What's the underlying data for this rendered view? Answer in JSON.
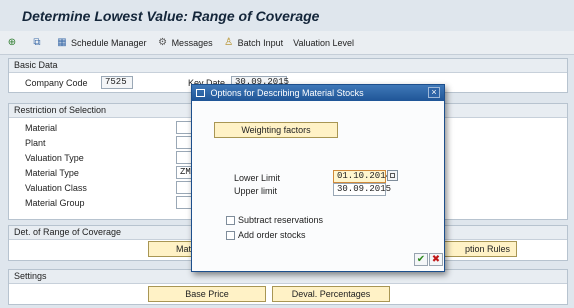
{
  "title": "Determine Lowest Value: Range of Coverage",
  "toolbar": {
    "schedule_manager": "Schedule Manager",
    "messages": "Messages",
    "batch_input": "Batch Input",
    "valuation_level": "Valuation Level"
  },
  "basic_data": {
    "header": "Basic Data",
    "company_code_label": "Company Code",
    "company_code_value": "7525",
    "key_date_label": "Key Date",
    "key_date_value": "30.09.2015"
  },
  "restriction": {
    "header": "Restriction of Selection",
    "material": "Material",
    "plant": "Plant",
    "valuation_type": "Valuation Type",
    "material_type": "Material Type",
    "material_type_value": "ZMA",
    "valuation_class": "Valuation Class",
    "material_group": "Material Group"
  },
  "det_range": {
    "header": "Det. of Range of Coverage",
    "mat_button": "Mat",
    "rules_button": "ption Rules"
  },
  "settings": {
    "header": "Settings",
    "base_price": "Base Price",
    "deval_percentages": "Deval. Percentages"
  },
  "dialog": {
    "title": "Options for Describing Material Stocks",
    "close": "×",
    "weighting_factors": "Weighting factors",
    "lower_limit_label": "Lower Limit",
    "lower_limit_value": "01.10.2014",
    "upper_limit_label": "Upper limit",
    "upper_limit_value": "30.09.2015",
    "subtract_reservations": "Subtract reservations",
    "add_order_stocks": "Add order stocks",
    "ok": "✔",
    "cancel": "✖"
  }
}
